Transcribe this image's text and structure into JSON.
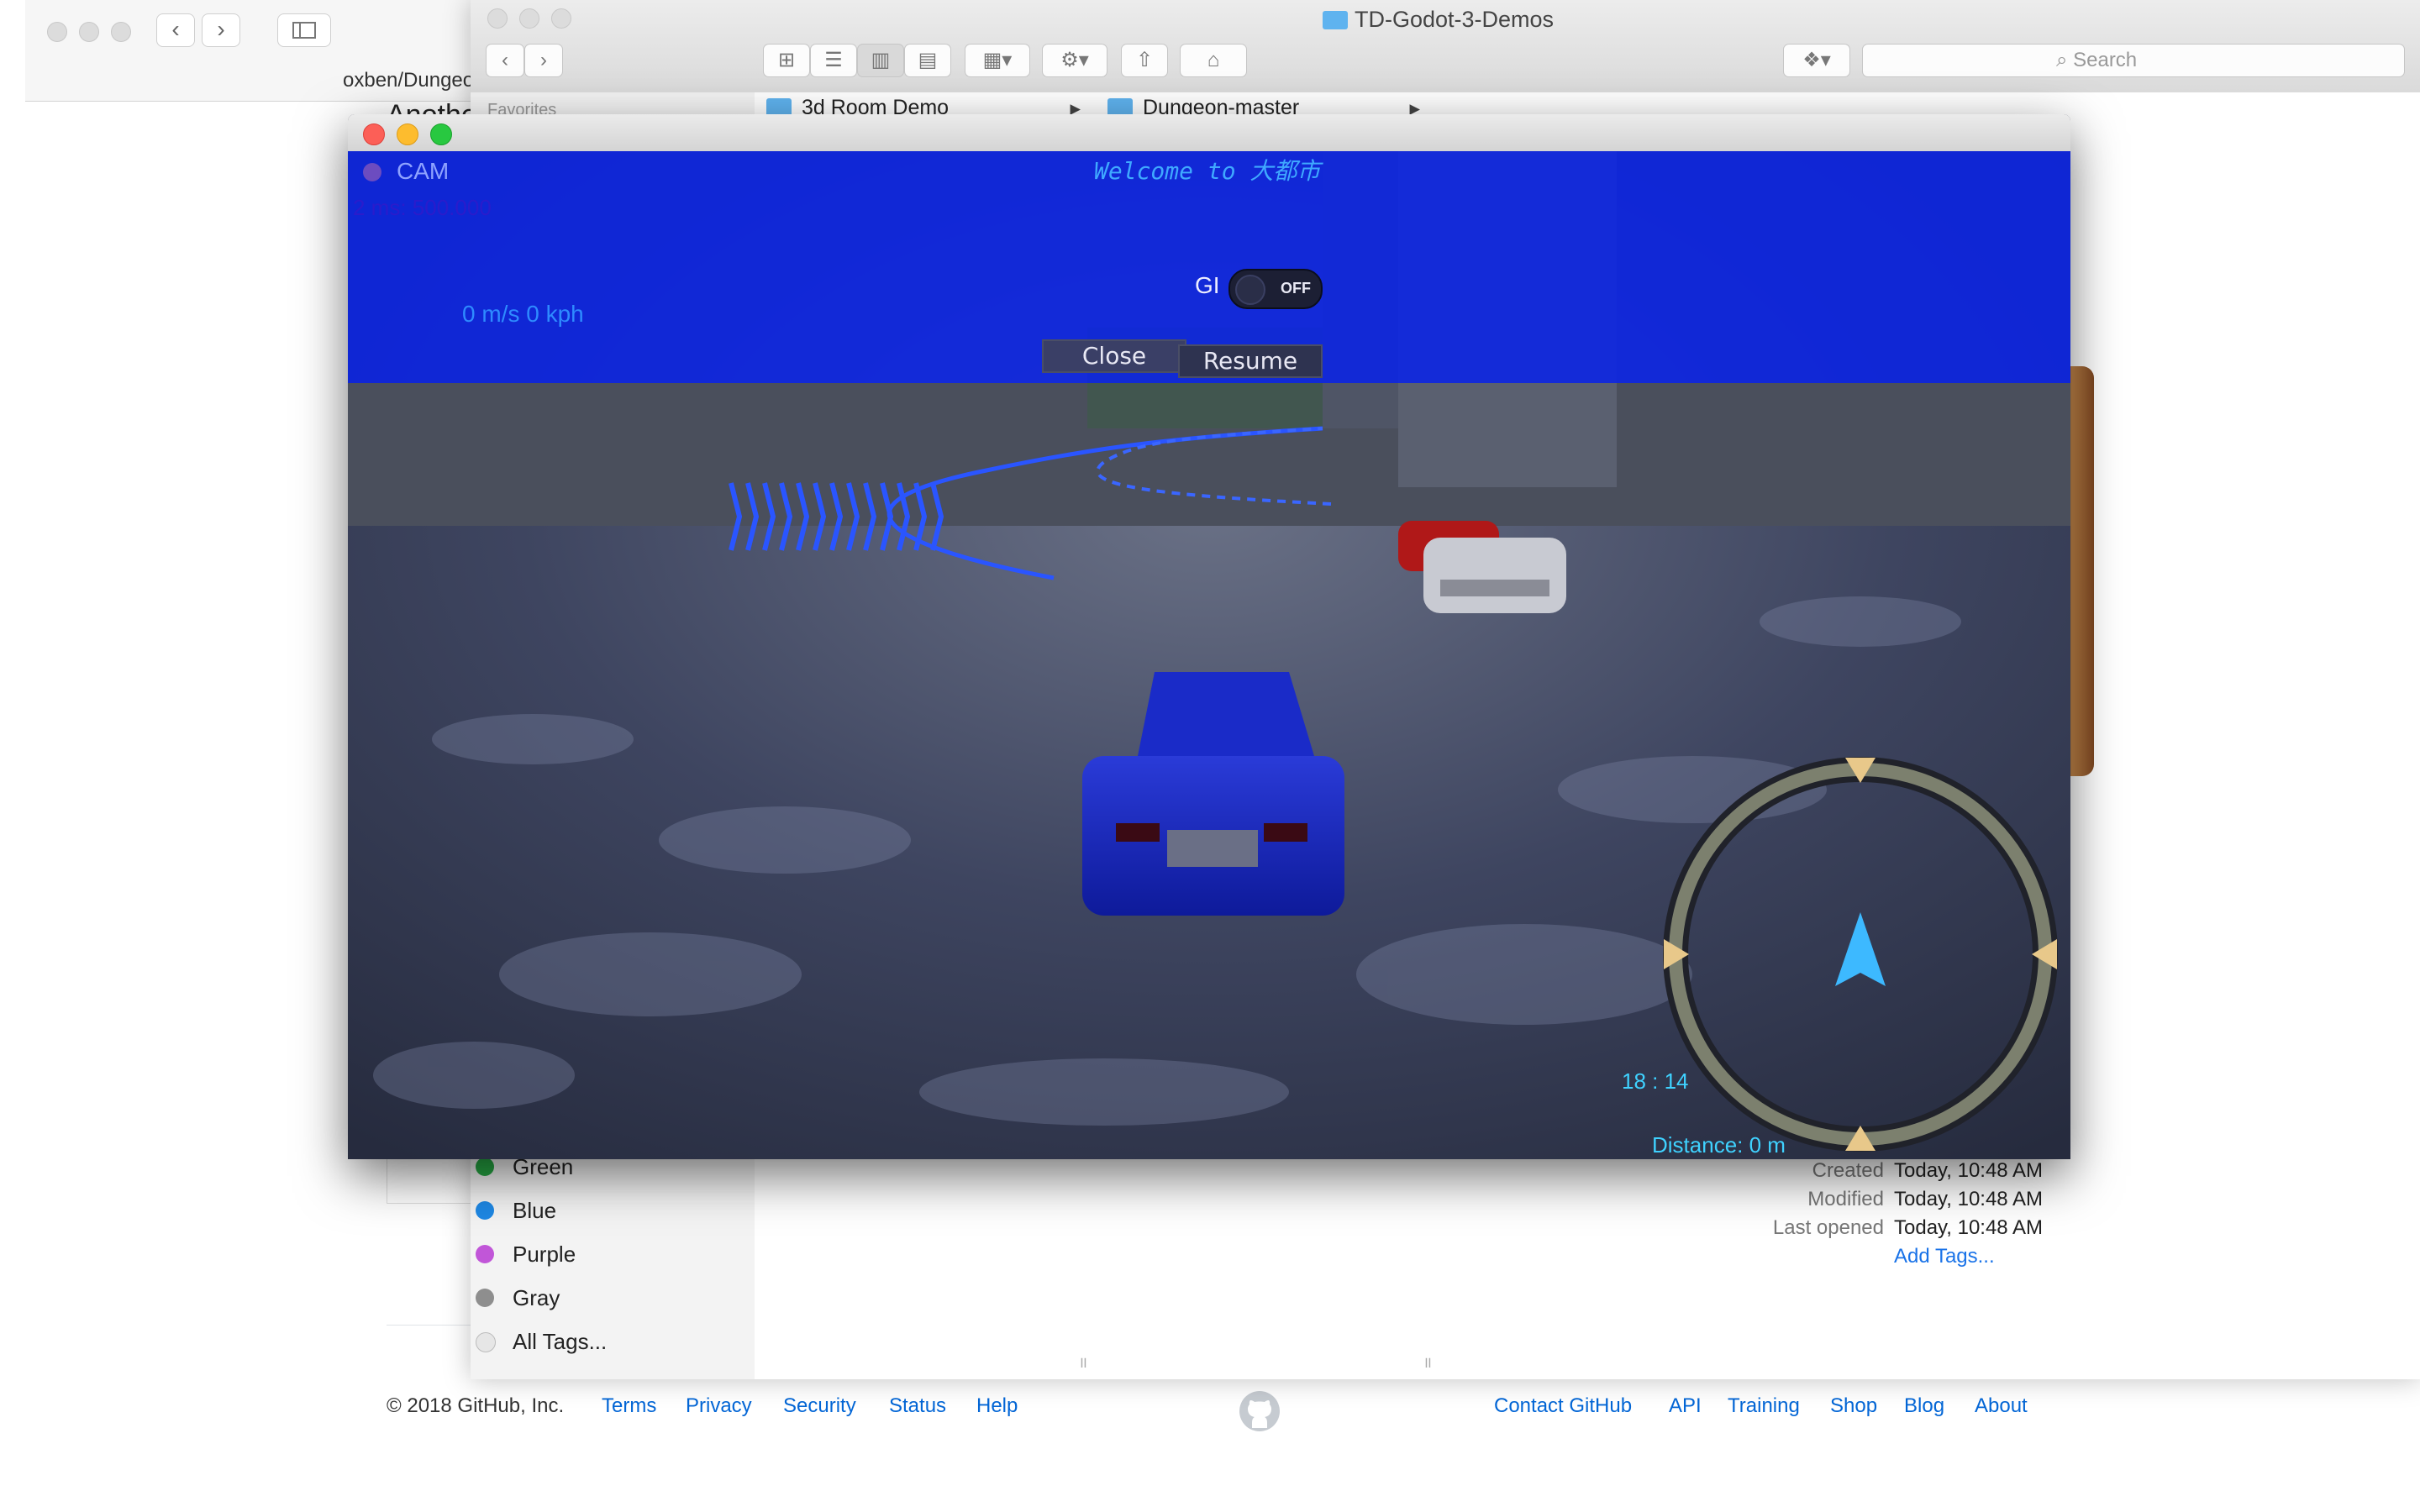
{
  "browser": {
    "address_fragment": "oxben/Dungeo",
    "page_heading_fragment": "Anothe",
    "footer": {
      "copyright": "© 2018 GitHub, Inc.",
      "left_links": [
        "Terms",
        "Privacy",
        "Security",
        "Status",
        "Help"
      ],
      "right_links": [
        "Contact GitHub",
        "API",
        "Training",
        "Shop",
        "Blog",
        "About"
      ]
    }
  },
  "finder": {
    "title": "TD-Godot-3-Demos",
    "search_placeholder": "Search",
    "sidebar_section": "Favorites",
    "column1_item": "3d Room Demo",
    "column2_item": "Dungeon-master",
    "tags": [
      {
        "label": "Green",
        "color": "#27a844"
      },
      {
        "label": "Blue",
        "color": "#1e88e5"
      },
      {
        "label": "Purple",
        "color": "#c156d8"
      },
      {
        "label": "Gray",
        "color": "#8e8e8e"
      },
      {
        "label": "All Tags...",
        "color": "#e6e6e6"
      }
    ],
    "info": {
      "created_label": "Created",
      "created_value": "Today, 10:48 AM",
      "modified_label": "Modified",
      "modified_value": "Today, 10:48 AM",
      "opened_label": "Last opened",
      "opened_value": "Today, 10:48 AM",
      "add_tags": "Add Tags..."
    }
  },
  "game": {
    "cam_label": "CAM",
    "timing_text": "2 ms: 500.000",
    "welcome": "Welcome to 大都市",
    "speed": "0 m/s 0 kph",
    "gi_label": "GI",
    "gi_state": "OFF",
    "close_button": "Close",
    "resume_button": "Resume",
    "clock": "18 : 14",
    "distance": "Distance: 0 m",
    "accent_color": "#0a23e6"
  }
}
